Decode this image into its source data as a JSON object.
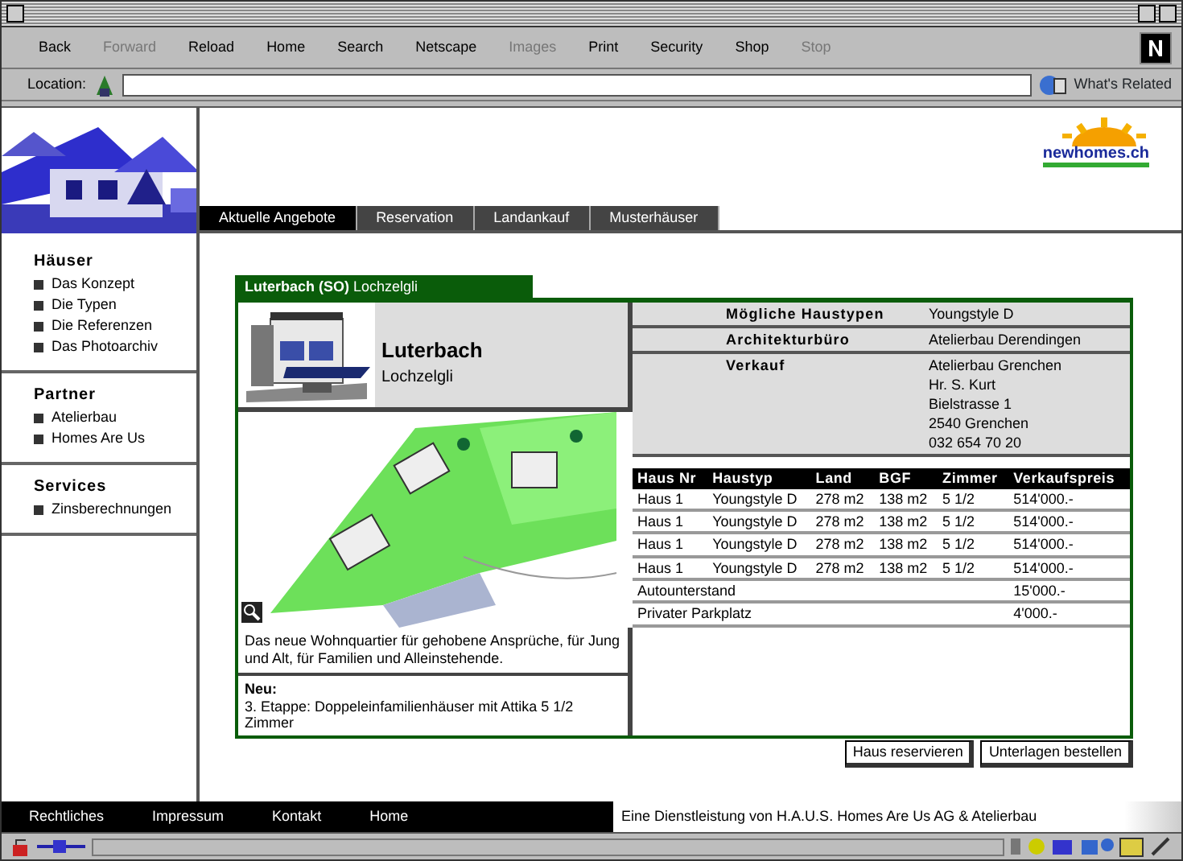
{
  "toolbar": [
    {
      "label": "Back",
      "disabled": false
    },
    {
      "label": "Forward",
      "disabled": true
    },
    {
      "label": "Reload",
      "disabled": false
    },
    {
      "label": "Home",
      "disabled": false
    },
    {
      "label": "Search",
      "disabled": false
    },
    {
      "label": "Netscape",
      "disabled": false
    },
    {
      "label": "Images",
      "disabled": true
    },
    {
      "label": "Print",
      "disabled": false
    },
    {
      "label": "Security",
      "disabled": false
    },
    {
      "label": "Shop",
      "disabled": false
    },
    {
      "label": "Stop",
      "disabled": true
    }
  ],
  "location": {
    "label": "Location:",
    "related": "What's Related"
  },
  "logo": {
    "text": "newhomes.ch"
  },
  "tabs": [
    {
      "label": "Aktuelle Angebote",
      "selected": true
    },
    {
      "label": "Reservation",
      "selected": false
    },
    {
      "label": "Landankauf",
      "selected": false
    },
    {
      "label": "Musterhäuser",
      "selected": false
    }
  ],
  "sidebar": [
    {
      "title": "Häuser",
      "items": [
        "Das Konzept",
        "Die Typen",
        "Die Referenzen",
        "Das Photoarchiv"
      ]
    },
    {
      "title": "Partner",
      "items": [
        "Atelierbau",
        "Homes Are Us"
      ]
    },
    {
      "title": "Services",
      "items": [
        "Zinsberechnungen"
      ]
    }
  ],
  "project": {
    "tab_bold": "Luterbach (SO)",
    "tab_rest": "Lochzelgli",
    "title": "Luterbach",
    "subtitle": "Lochzelgli",
    "description": "Das neue Wohnquartier für gehobene Ansprüche, für Jung und Alt, für Familien und Alleinstehende.",
    "news_title": "Neu:",
    "news_text": "3. Etappe: Doppeleinfamilienhäuser mit Attika 5 1/2 Zimmer"
  },
  "info": [
    {
      "label": "Mögliche Haustypen",
      "lines": [
        "Youngstyle D"
      ]
    },
    {
      "label": "Architekturbüro",
      "lines": [
        "Atelierbau Derendingen"
      ]
    },
    {
      "label": "Verkauf",
      "lines": [
        "Atelierbau Grenchen",
        "Hr. S. Kurt",
        "Bielstrasse 1",
        "2540 Grenchen",
        "032 654 70 20"
      ]
    }
  ],
  "prices": {
    "columns": [
      "Haus Nr",
      "Haustyp",
      "Land",
      "BGF",
      "Zimmer",
      "Verkaufspreis"
    ],
    "rows": [
      {
        "kind": "house",
        "cells": [
          "Haus 1",
          "Youngstyle D",
          "278 m2",
          "138 m2",
          "5 1/2",
          "514'000.-"
        ]
      },
      {
        "kind": "house",
        "cells": [
          "Haus 1",
          "Youngstyle D",
          "278 m2",
          "138 m2",
          "5 1/2",
          "514'000.-"
        ]
      },
      {
        "kind": "house",
        "cells": [
          "Haus 1",
          "Youngstyle D",
          "278 m2",
          "138 m2",
          "5 1/2",
          "514'000.-"
        ]
      },
      {
        "kind": "house",
        "cells": [
          "Haus 1",
          "Youngstyle D",
          "278 m2",
          "138 m2",
          "5 1/2",
          "514'000.-"
        ]
      },
      {
        "kind": "extra",
        "cells": [
          {
            "text": "Autounterstand",
            "colspan": 5
          },
          "15'000.-"
        ]
      },
      {
        "kind": "extra",
        "cells": [
          {
            "text": "Privater Parkplatz",
            "colspan": 5
          },
          "4'000.-"
        ]
      }
    ]
  },
  "actions": [
    "Haus reservieren",
    "Unterlagen bestellen"
  ],
  "footer": {
    "links": [
      "Rechtliches",
      "Impressum",
      "Kontakt",
      "Home"
    ],
    "credit": "Eine Dienstleistung von H.A.U.S. Homes Are Us AG & Atelierbau"
  }
}
